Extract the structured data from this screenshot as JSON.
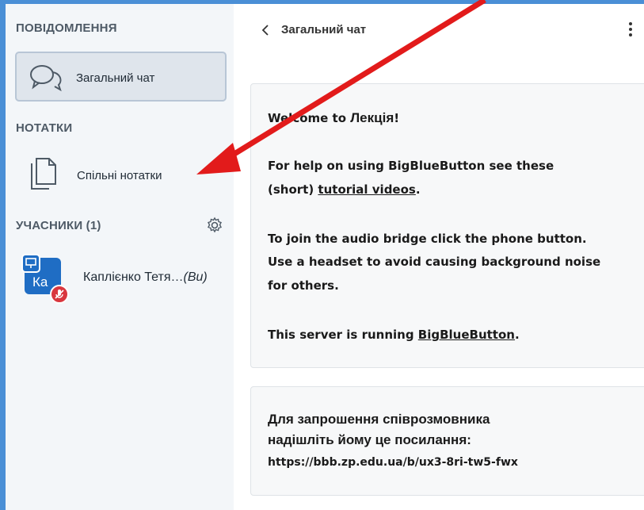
{
  "sidebar": {
    "messages_title": "ПОВІДОМЛЕННЯ",
    "public_chat_label": "Загальний чат",
    "notes_title": "НОТАТКИ",
    "shared_notes_label": "Спільні нотатки",
    "users_title": "УЧАСНИКИ (1)",
    "user": {
      "initials": "Ка",
      "name": "Каплієнко Тетя…",
      "suffix": "(Ви)"
    }
  },
  "chat": {
    "title": "Загальний чат",
    "welcome": {
      "prefix": "Welcome to ",
      "meeting_name": "Лекція",
      "suffix": "!",
      "help_line1": "For help on using BigBlueButton see these",
      "help_line2_prefix": "(short) ",
      "help_link": "tutorial videos",
      "help_line2_suffix": ".",
      "audio_line1": "To join the audio bridge click the phone button.",
      "audio_line2": "Use a headset to avoid causing background noise",
      "audio_line3": "for others.",
      "server_prefix": "This server is running ",
      "server_link": "BigBlueButton",
      "server_suffix": "."
    },
    "invite": {
      "line1": "Для запрошення співрозмовника",
      "line2": "надішліть йому це посилання:",
      "url": "https://bbb.zp.edu.ua/b/ux3-8ri-tw5-fwx"
    }
  },
  "colors": {
    "accent": "#1f6dc4",
    "arrow": "#e21b1b",
    "muted_badge": "#d9363e"
  }
}
